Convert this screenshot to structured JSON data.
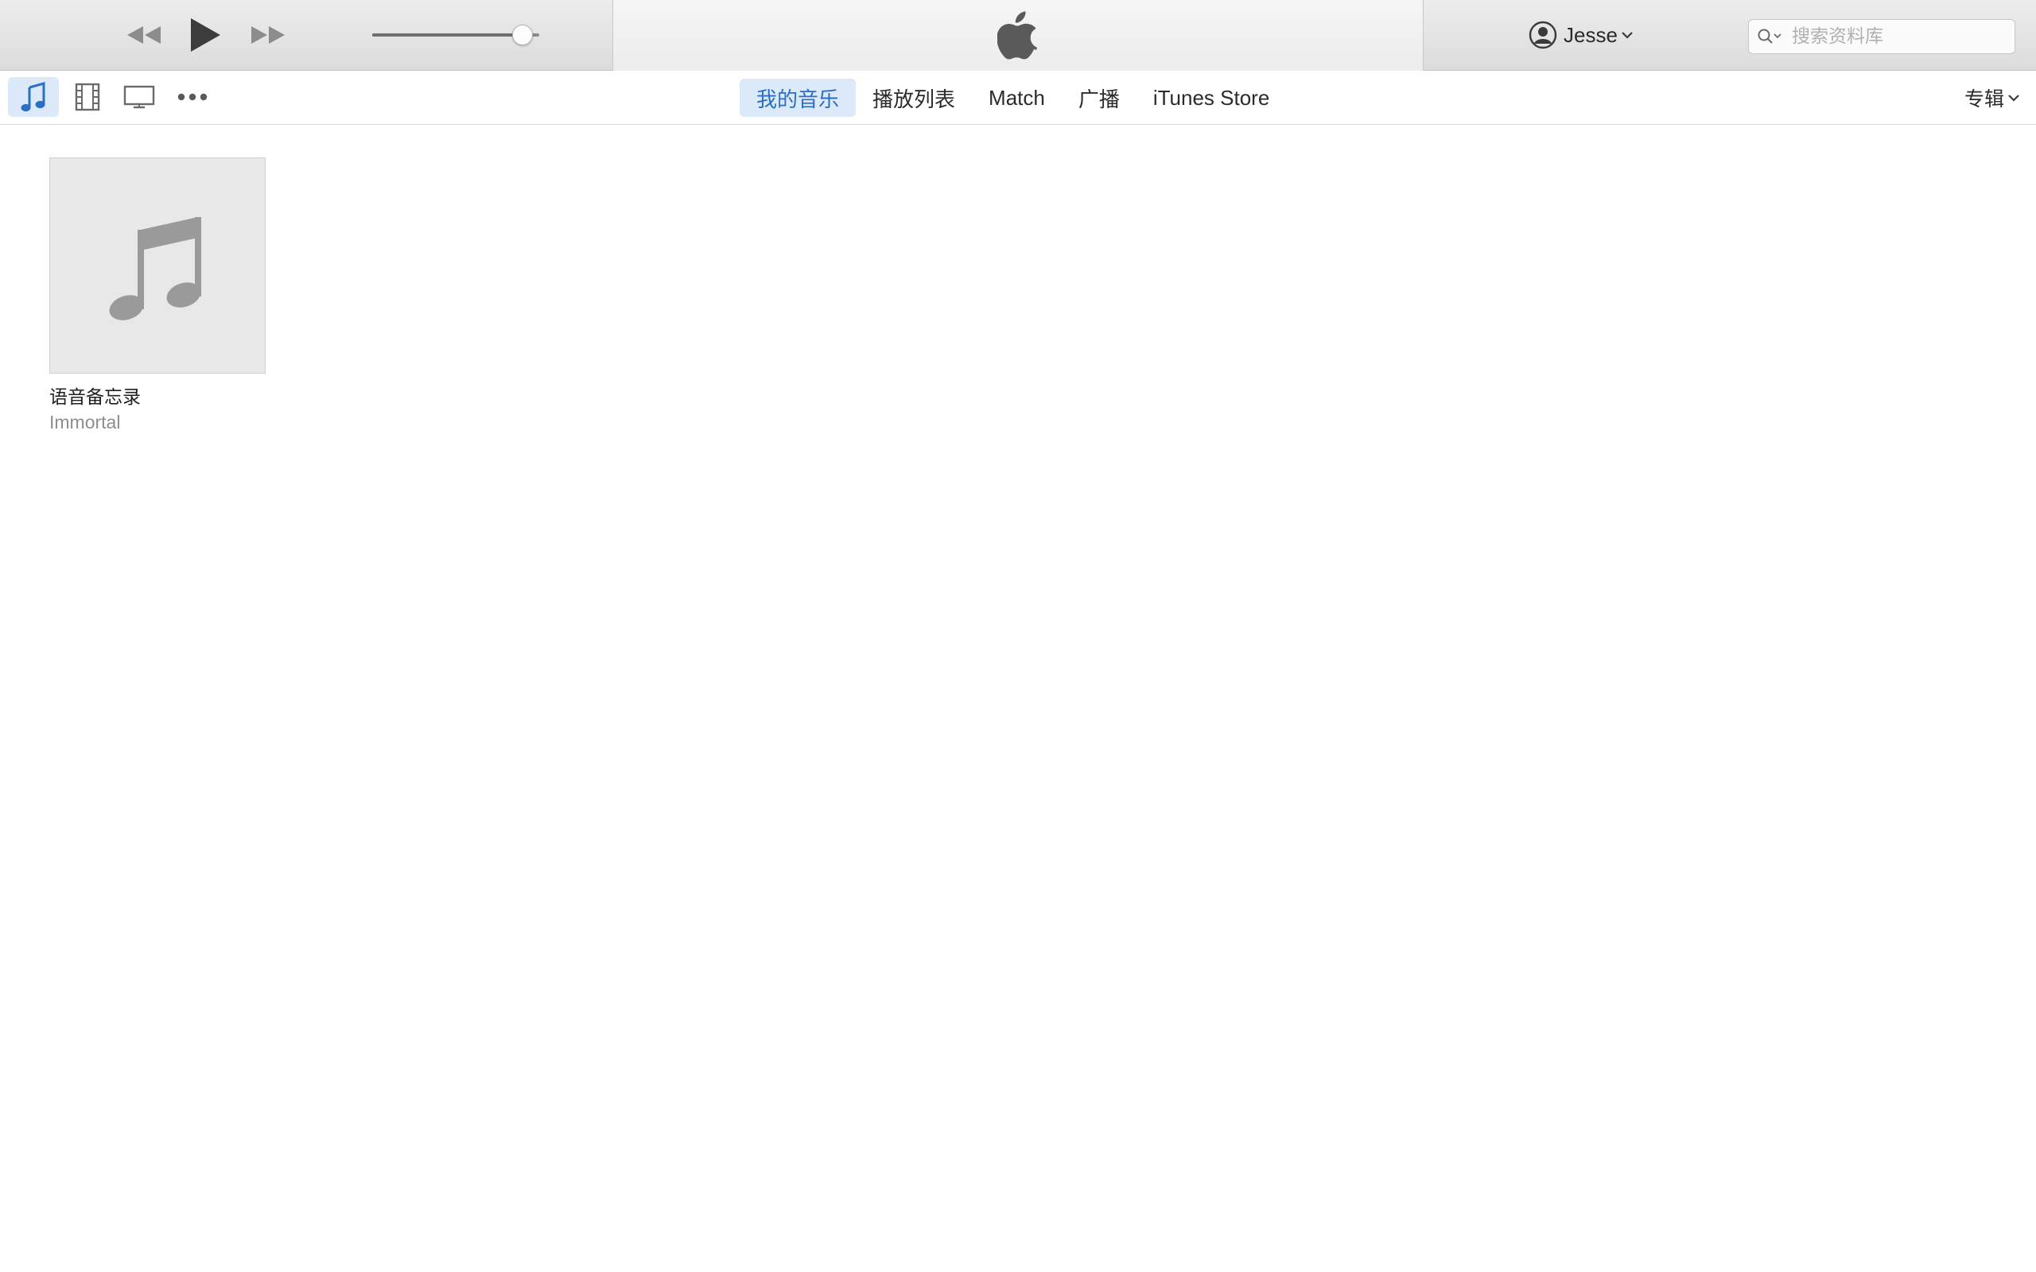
{
  "toolbar": {
    "rewind_icon": "rewind-icon",
    "play_icon": "play-icon",
    "forward_icon": "fast-forward-icon",
    "volume_level": 0.9,
    "lcd_icon": "apple-logo-icon",
    "account": {
      "icon": "user-circle-icon",
      "name": "Jesse"
    },
    "search": {
      "placeholder": "搜索资料库"
    }
  },
  "navbar": {
    "media_kinds": [
      {
        "name": "music",
        "icon": "music-note-icon",
        "active": true
      },
      {
        "name": "movies",
        "icon": "film-icon",
        "active": false
      },
      {
        "name": "tv",
        "icon": "tv-icon",
        "active": false
      },
      {
        "name": "more",
        "icon": "more-icon",
        "active": false
      }
    ],
    "tabs": [
      {
        "label": "我的音乐",
        "active": true
      },
      {
        "label": "播放列表",
        "active": false
      },
      {
        "label": "Match",
        "active": false
      },
      {
        "label": "广播",
        "active": false
      },
      {
        "label": "iTunes Store",
        "active": false
      }
    ],
    "view_selector": "专辑"
  },
  "albums": [
    {
      "title": "语音备忘录",
      "artist": "Immortal",
      "artwork_icon": "music-note-icon"
    }
  ],
  "colors": {
    "accent": "#2a6fc4",
    "active_bg": "#dce9f8",
    "icon_gray": "#6a6a6a"
  }
}
